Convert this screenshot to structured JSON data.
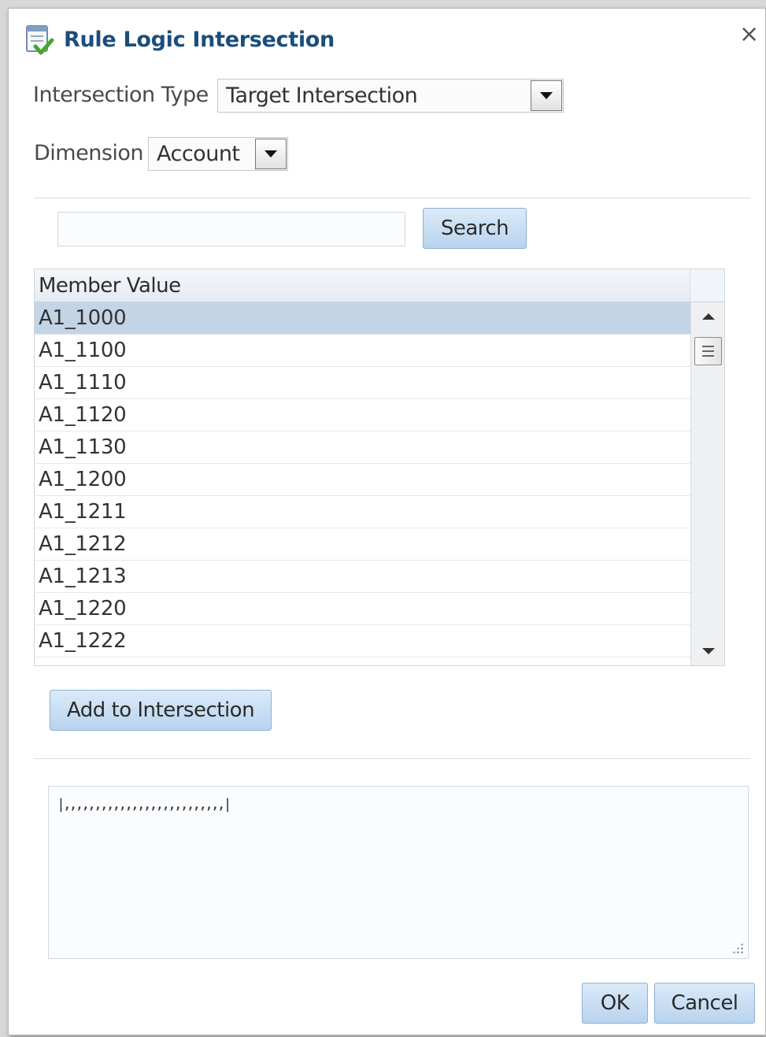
{
  "dialog": {
    "title": "Rule Logic Intersection",
    "close_symbol": "×",
    "icon": "checklist-icon"
  },
  "intersection_type": {
    "label": "Intersection Type",
    "value": "Target Intersection"
  },
  "dimension": {
    "label": "Dimension",
    "value": "Account"
  },
  "search": {
    "input_value": "",
    "button_label": "Search"
  },
  "table": {
    "column_header": "Member Value",
    "selected_index": 0,
    "rows": [
      "A1_1000",
      "A1_1100",
      "A1_1110",
      "A1_1120",
      "A1_1130",
      "A1_1200",
      "A1_1211",
      "A1_1212",
      "A1_1213",
      "A1_1220",
      "A1_1222"
    ]
  },
  "add_button_label": "Add to Intersection",
  "intersection_text": "|,,,,,,,,,,,,,,,,,,,,,,,,,,|",
  "footer": {
    "ok_label": "OK",
    "cancel_label": "Cancel"
  },
  "colors": {
    "title": "#1b4e7c",
    "selected_row": "#c3d4e7",
    "button": "#b9d3ee"
  }
}
